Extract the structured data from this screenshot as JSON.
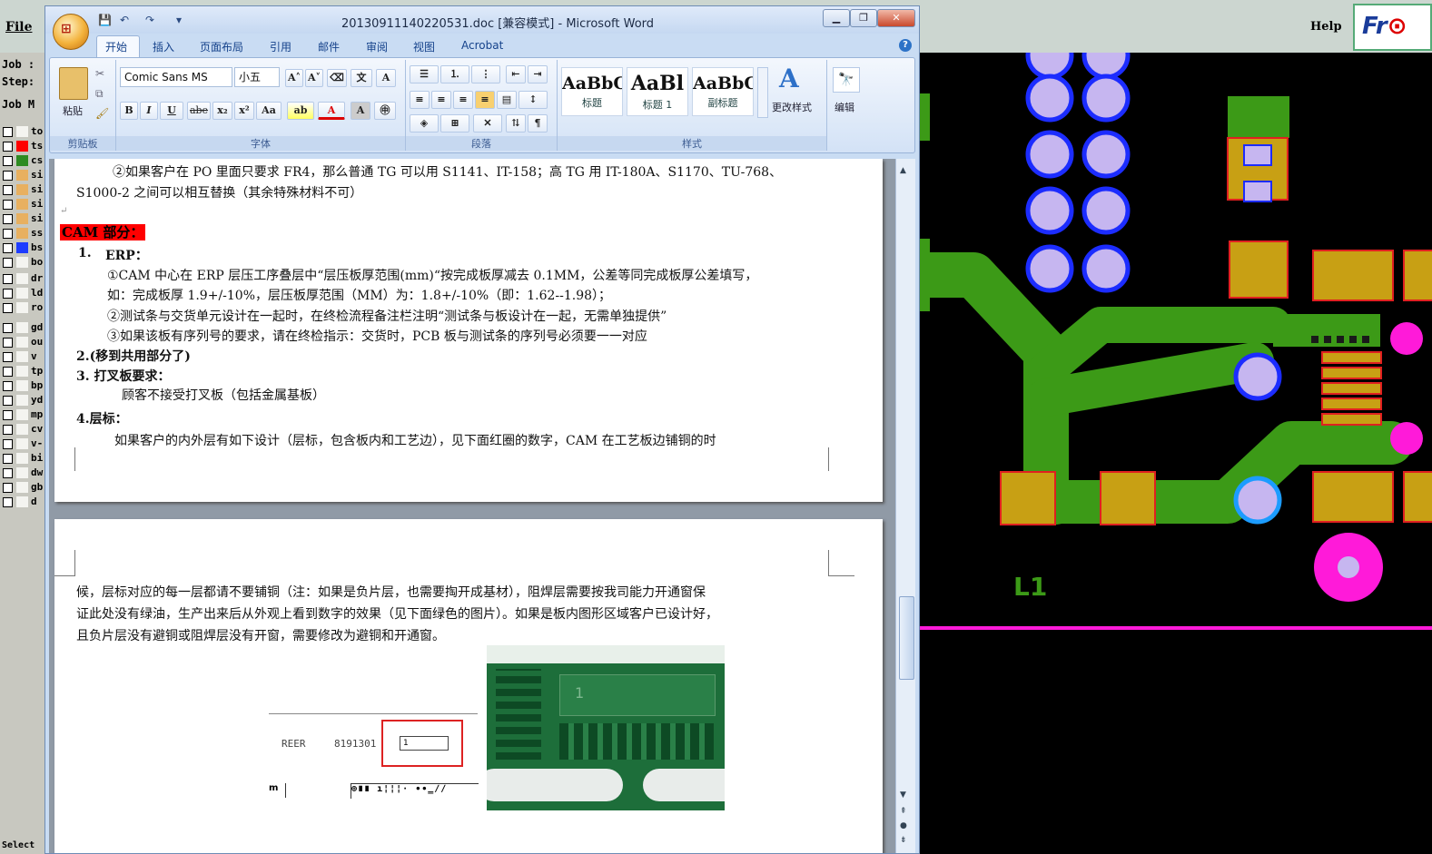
{
  "cam": {
    "menu_file": "File",
    "menu_help": "Help",
    "logo_text_a": "Fr",
    "logo_text_b": "⊙",
    "labels": [
      "Job :",
      "Step:",
      "Job M"
    ],
    "layers": [
      {
        "name": "to",
        "color": "#000000"
      },
      {
        "name": "ts",
        "color": "#ff0000"
      },
      {
        "name": "cs",
        "color": "#2e8b22"
      },
      {
        "name": "si",
        "color": "#e8b060"
      },
      {
        "name": "si",
        "color": "#e8b060"
      },
      {
        "name": "si",
        "color": "#e8b060"
      },
      {
        "name": "si",
        "color": "#e8b060"
      },
      {
        "name": "ss",
        "color": "#e8b060"
      },
      {
        "name": "bs",
        "color": "#1e3cff"
      },
      {
        "name": "bo",
        "color": "#000000"
      },
      {
        "name": "dr",
        "color": "#000000"
      },
      {
        "name": "ld",
        "color": "#000000"
      },
      {
        "name": "ro",
        "color": "#000000"
      },
      {
        "name": "gd",
        "color": "#000000"
      },
      {
        "name": "ou",
        "color": "#000000"
      },
      {
        "name": "v",
        "color": "#000000"
      },
      {
        "name": "tp",
        "color": "#000000"
      },
      {
        "name": "bp",
        "color": "#000000"
      },
      {
        "name": "yd",
        "color": "#000000"
      },
      {
        "name": "mp",
        "color": "#000000"
      },
      {
        "name": "cv",
        "color": "#000000"
      },
      {
        "name": "v-",
        "color": "#000000"
      },
      {
        "name": "bi",
        "color": "#000000"
      },
      {
        "name": "dw",
        "color": "#000000"
      },
      {
        "name": "gb",
        "color": "#000000"
      },
      {
        "name": "d",
        "color": "#000000"
      }
    ],
    "canvas_label": "L1",
    "bottom_label": "Select"
  },
  "word": {
    "title": "20130911140220531.doc [兼容模式] - Microsoft Word",
    "office_glyph": "⊞",
    "qat": [
      "💾",
      "↶",
      "↷",
      "▾"
    ],
    "controls": {
      "minimize": "▁",
      "restore": "❐",
      "close": "✕"
    },
    "tabs": [
      "开始",
      "插入",
      "页面布局",
      "引用",
      "邮件",
      "审阅",
      "视图",
      "Acrobat"
    ],
    "help": "?",
    "ribbon": {
      "clipboard_label": "剪贴板",
      "paste_label": "粘贴",
      "font_group_label": "字体",
      "paragraph_group_label": "段落",
      "styles_group_label": "样式",
      "font_name": "Comic Sans MS",
      "font_size": "小五",
      "font_buttons": [
        "B",
        "I",
        "U",
        "abe",
        "x₂",
        "x²",
        "Aa"
      ],
      "grow_shrink": [
        "A˄",
        "A˅"
      ],
      "styles": [
        {
          "sample": "AaBbC",
          "name": "标题"
        },
        {
          "sample": "AaBl",
          "name": "标题 1"
        },
        {
          "sample": "AaBbC",
          "name": "副标题"
        }
      ],
      "change_styles": "更改样式",
      "edit_label": "编辑"
    },
    "doc": {
      "p1_line1": "②如果客户在 PO 里面只要求 FR4，那么普通 TG 可以用 S1141、IT-158；高 TG 用 IT-180A、S1170、TU-768、",
      "p1_line2": "S1000-2 之间可以相互替换（其余特殊材料不可）",
      "cam_heading": "CAM 部分：",
      "item1_num": "1.",
      "item1_title": "ERP：",
      "item1_l1": "①CAM 中心在 ERP 层压工序叠层中“层压板厚范围(mm)“按完成板厚减去 0.1MM，公差等同完成板厚公差填写，",
      "item1_l2": "如：完成板厚 1.9+/-10%，层压板厚范围（MM）为：1.8+/-10%（即：1.62--1.98）；",
      "item1_l3": "②测试条与交货单元设计在一起时，在终检流程备注栏注明“测试条与板设计在一起，无需单独提供”",
      "item1_l4": "③如果该板有序列号的要求，请在终检指示：交货时，PCB 板与测试条的序列号必须要一一对应",
      "item2": "2.(移到共用部分了)",
      "item3_title": "3.  打叉板要求：",
      "item3_body": "顾客不接受打叉板（包括金属基板）",
      "item4_title": "4.层标：",
      "item4_body": "如果客户的内外层有如下设计（层标，包含板内和工艺边），见下面红圈的数字，CAM 在工艺板边铺铜的时",
      "p2_l1": "候，层标对应的每一层都请不要铺铜（注：如果是负片层，也需要掏开成基材），阻焊层需要按我司能力开通窗保",
      "p2_l2": "证此处没有绿油，生产出来后从外观上看到数字的效果（见下面绿色的图片）。如果是板内图形区域客户已设计好，",
      "p2_l3": "且负片层没有避铜或阻焊层没有开窗，需要修改为避铜和开通窗。",
      "fig_left_a": "REER",
      "fig_left_b": "8191301",
      "fig_box_digit": "1",
      "fig_right_digit": "1",
      "para_mark": "↵"
    }
  }
}
